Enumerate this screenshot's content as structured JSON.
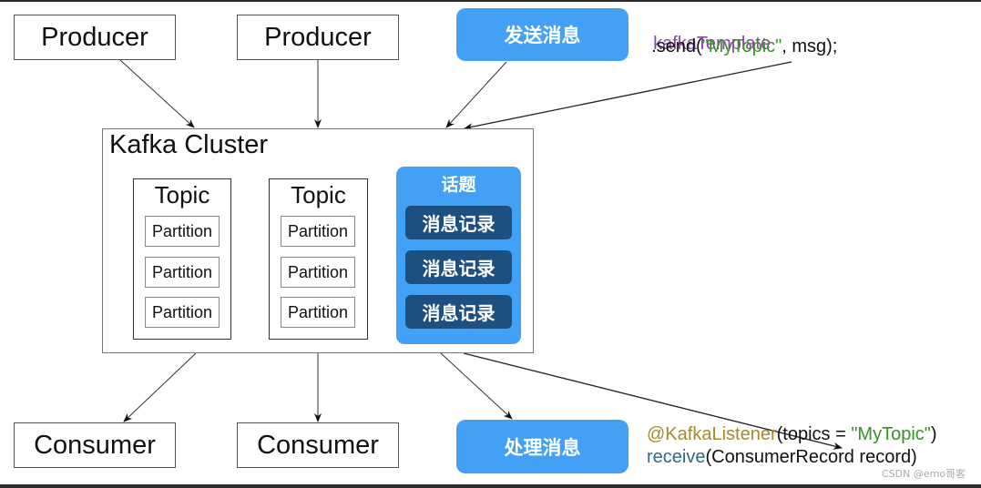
{
  "diagram": {
    "producers": [
      {
        "label": "Producer"
      },
      {
        "label": "Producer"
      }
    ],
    "send_action": {
      "label": "发送消息"
    },
    "send_code": {
      "line1": "kafkaTemplate",
      "line2_prefix": "  .send(",
      "line2_topic": "\"MyTopic\"",
      "line2_suffix": ", msg);"
    },
    "cluster": {
      "title": "Kafka Cluster",
      "topics": [
        {
          "title": "Topic",
          "partitions": [
            "Partition",
            "Partition",
            "Partition"
          ]
        },
        {
          "title": "Topic",
          "partitions": [
            "Partition",
            "Partition",
            "Partition"
          ]
        }
      ],
      "highlighted_topic": {
        "title": "话题",
        "records": [
          "消息记录",
          "消息记录",
          "消息记录"
        ]
      }
    },
    "consumers": [
      {
        "label": "Consumer"
      },
      {
        "label": "Consumer"
      }
    ],
    "receive_action": {
      "label": "处理消息"
    },
    "receive_code": {
      "annotation": "@KafkaListener",
      "annotation_open": "(topics = ",
      "annotation_topic": "\"MyTopic\"",
      "annotation_close": ")",
      "method": "receive",
      "method_args": "(ConsumerRecord record)"
    },
    "watermark": "CSDN @emo哥客"
  },
  "colors": {
    "action_blue": "#42a1f5",
    "record_dark_blue": "#1d4f80",
    "keyword_purple": "#8e44a8",
    "string_green": "#3a8f2a",
    "annotation_olive": "#a48a2c",
    "method_teal": "#2e6a86"
  }
}
